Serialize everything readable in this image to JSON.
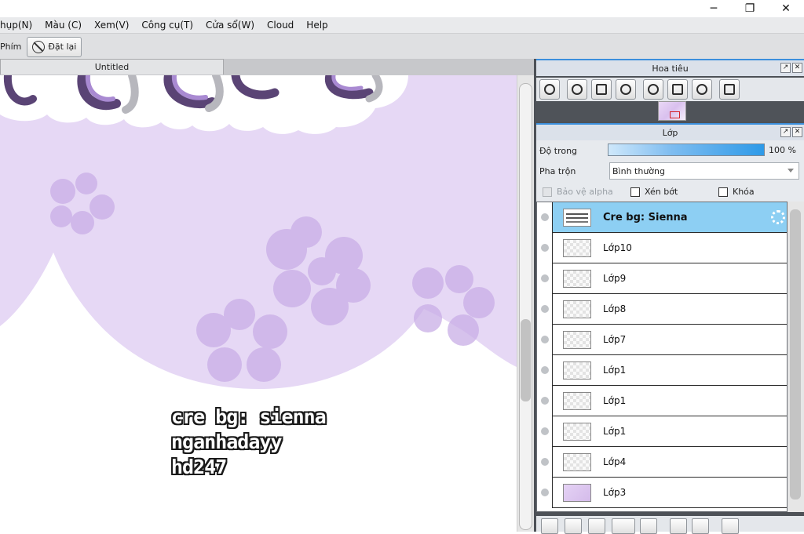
{
  "window": {
    "minimize_icon": "─",
    "restore_icon": "❐",
    "close_icon": "✕"
  },
  "menu": {
    "items": [
      {
        "label": "hụp(N)"
      },
      {
        "label": "Màu (C)"
      },
      {
        "label": "Xem(V)"
      },
      {
        "label": "Công cụ(T)"
      },
      {
        "label": "Cửa sổ(W)"
      },
      {
        "label": "Cloud"
      },
      {
        "label": "Help"
      }
    ]
  },
  "toolbar": {
    "shortcut_label": "Phím",
    "reset_label": "Đặt lại"
  },
  "document": {
    "tab_title": "Untitled",
    "canvas_text": [
      "cre bg: sienna",
      "nganhadayy",
      "hd247"
    ],
    "colors": {
      "lavender": "#e6d8f5",
      "flower": "#c9aee6",
      "ribbon": "#5a4475",
      "ribbon_light": "#9b7fc4"
    }
  },
  "navigator": {
    "title": "Hoa tiêu",
    "tools": [
      "zoom-in-icon",
      "zoom-in-icon",
      "fit-screen-icon",
      "zoom-out-icon",
      "rotate-left-icon",
      "reset-view-icon",
      "rotate-right-icon",
      "flip-icon"
    ]
  },
  "layers_panel": {
    "title": "Lớp",
    "opacity_label": "Độ trong",
    "opacity_value": "100 %",
    "opacity_fraction": 1.0,
    "blend_label": "Pha trộn",
    "blend_value": "Bình thường",
    "checkboxes": [
      {
        "label": "Bảo vệ alpha",
        "checked": false,
        "disabled": true
      },
      {
        "label": "Xén bớt",
        "checked": false,
        "disabled": false
      },
      {
        "label": "Khóa",
        "checked": false,
        "disabled": false
      }
    ],
    "layers": [
      {
        "name": "Cre bg: Sienna",
        "selected": true,
        "thumb": "text"
      },
      {
        "name": "Lớp10",
        "selected": false,
        "thumb": "empty"
      },
      {
        "name": "Lớp9",
        "selected": false,
        "thumb": "empty"
      },
      {
        "name": "Lớp8",
        "selected": false,
        "thumb": "empty"
      },
      {
        "name": "Lớp7",
        "selected": false,
        "thumb": "empty"
      },
      {
        "name": "Lớp1",
        "selected": false,
        "thumb": "empty"
      },
      {
        "name": "Lớp1",
        "selected": false,
        "thumb": "empty"
      },
      {
        "name": "Lớp1",
        "selected": false,
        "thumb": "empty"
      },
      {
        "name": "Lớp4",
        "selected": false,
        "thumb": "empty"
      },
      {
        "name": "Lớp3",
        "selected": false,
        "thumb": "purple"
      }
    ],
    "accent": "#8dcff3"
  }
}
